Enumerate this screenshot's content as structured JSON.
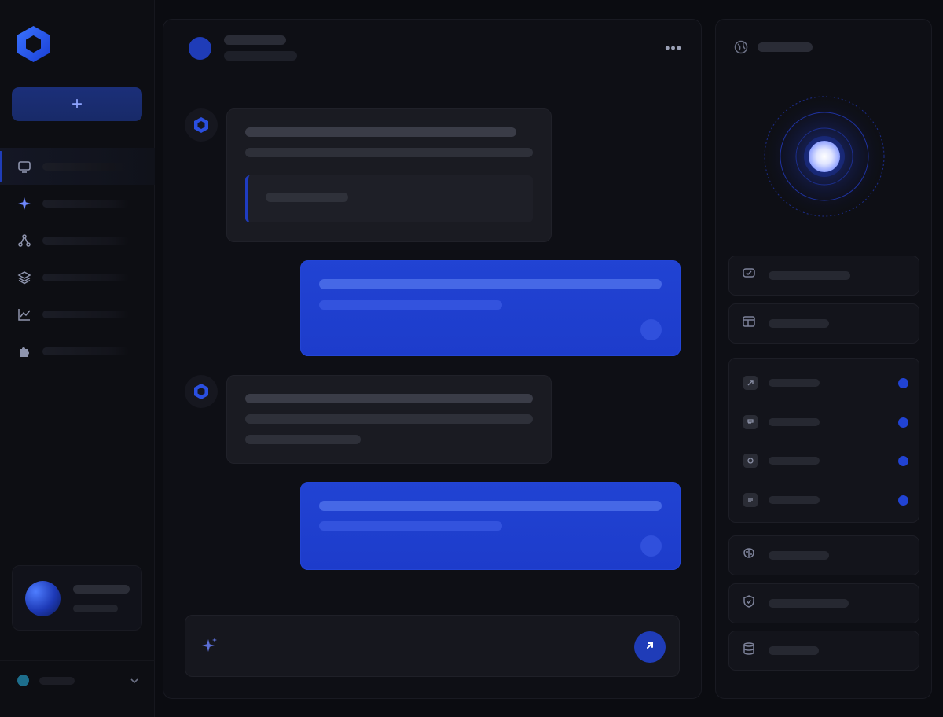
{
  "colors": {
    "accent": "#1F3CB8",
    "user_bubble": "#2143D3",
    "background": "#0B0C11",
    "panel": "#0E0F15",
    "status_dot": "#2143D3"
  },
  "sidebar": {
    "logo_icon": "hexagon-logo-icon",
    "new_button_label": "+",
    "nav": [
      {
        "icon": "chat-icon",
        "label": ""
      },
      {
        "icon": "sparkle-icon",
        "label": ""
      },
      {
        "icon": "graph-nodes-icon",
        "label": ""
      },
      {
        "icon": "layers-icon",
        "label": ""
      },
      {
        "icon": "chart-line-icon",
        "label": ""
      },
      {
        "icon": "puzzle-icon",
        "label": ""
      }
    ],
    "profile": {
      "name": "",
      "status": ""
    },
    "workspace": {
      "name": "",
      "icon": "chevron-down-icon"
    }
  },
  "chat": {
    "header": {
      "title": "",
      "subtitle": "",
      "menu_icon": "more-horizontal-icon"
    },
    "messages": [
      {
        "role": "assistant",
        "icon": "hexagon-avatar-icon"
      },
      {
        "role": "user"
      },
      {
        "role": "assistant",
        "icon": "hexagon-avatar-icon"
      },
      {
        "role": "user"
      }
    ],
    "composer": {
      "value": "",
      "placeholder": "",
      "spark_icon": "sparkle-icon",
      "send_icon": "arrow-up-icon"
    }
  },
  "right_panel": {
    "title": "",
    "title_icon": "globe-icon",
    "cards_top": [
      {
        "icon": "shield-chat-icon",
        "label": ""
      },
      {
        "icon": "window-icon",
        "label": ""
      }
    ],
    "integrations": [
      {
        "icon": "app-icon",
        "label": "",
        "status": "active"
      },
      {
        "icon": "app-icon",
        "label": "",
        "status": "active"
      },
      {
        "icon": "app-icon",
        "label": "",
        "status": "active"
      },
      {
        "icon": "app-icon",
        "label": "",
        "status": "active"
      }
    ],
    "cards_bottom": [
      {
        "icon": "brain-icon",
        "label": ""
      },
      {
        "icon": "shield-icon",
        "label": ""
      },
      {
        "icon": "database-icon",
        "label": ""
      }
    ]
  }
}
